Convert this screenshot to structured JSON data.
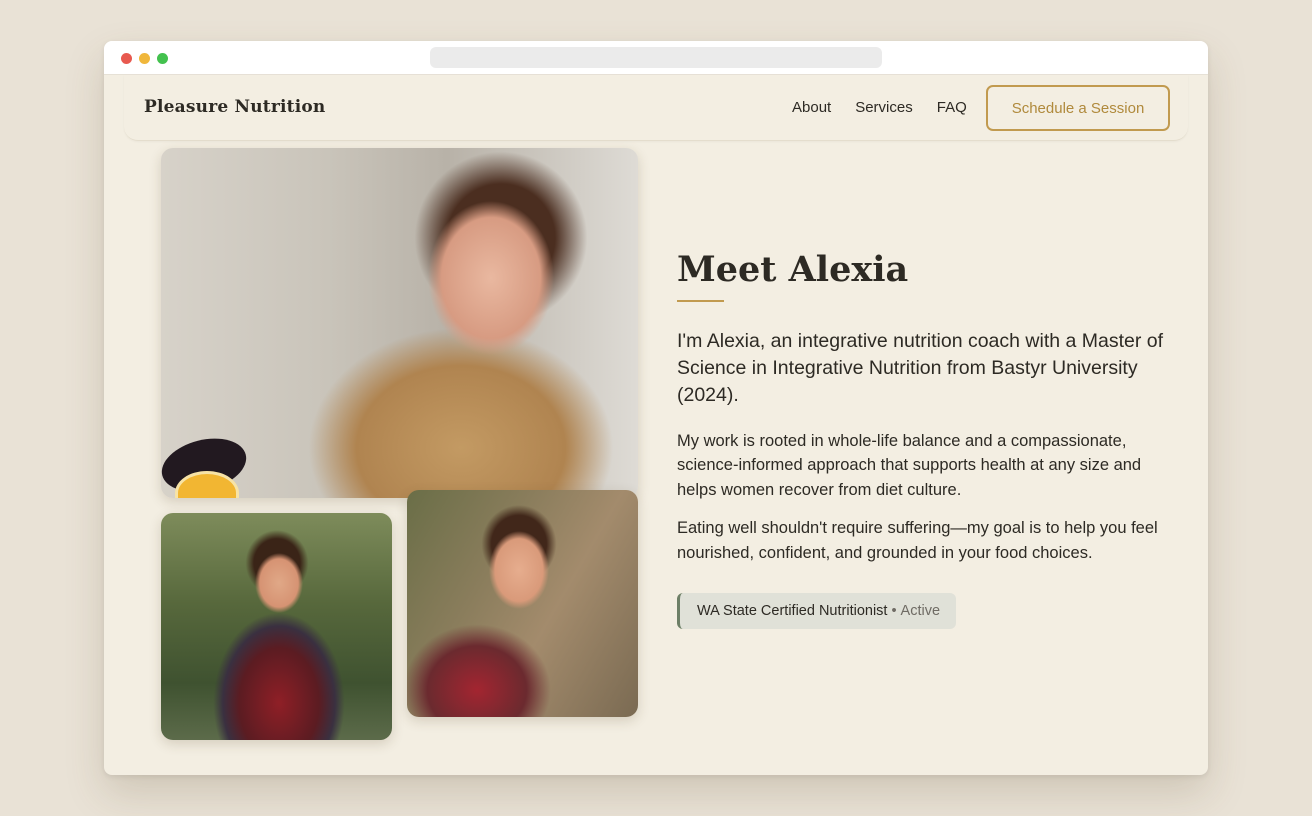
{
  "nav": {
    "brand": "Pleasure Nutrition",
    "links": [
      "About",
      "Services",
      "FAQ"
    ],
    "cta_label": "Schedule a Session"
  },
  "about": {
    "heading": "Meet Alexia",
    "lead": "I'm Alexia, an integrative nutrition coach with a Master of Science in Integrative Nutrition from Bastyr University (2024).",
    "paragraphs": [
      "My work is rooted in whole-life balance and a compassionate, science-informed approach that supports health at any size and helps women recover from diet culture.",
      "Eating well shouldn't require suffering—my goal is to help you feel nourished, confident, and grounded in your food choices."
    ],
    "badge": {
      "label": "WA State Certified Nutritionist",
      "separator": "•",
      "status": "Active"
    }
  },
  "colors": {
    "background": "#f3eee2",
    "accent": "#c19a4f",
    "text": "#2d2a24",
    "badge_bg": "#e0e1d8"
  }
}
